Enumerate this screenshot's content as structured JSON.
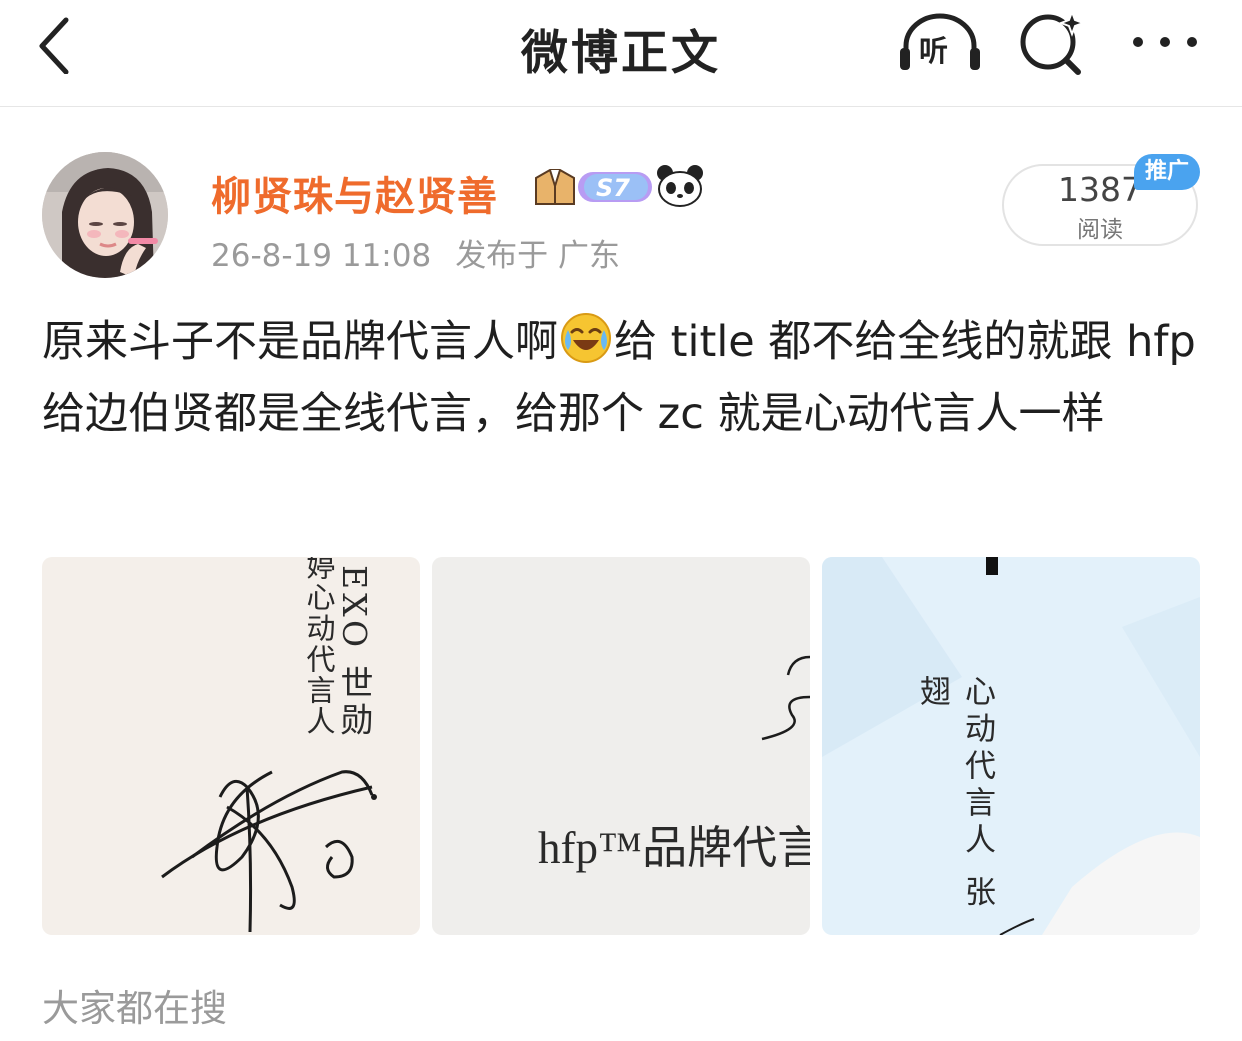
{
  "nav": {
    "title": "微博正文",
    "listen_label": "听",
    "back_icon": "chevron-left-icon",
    "search_icon": "search-sparkle-icon",
    "more_icon": "more-dots-icon"
  },
  "post": {
    "author": "柳贤珠与赵贤善",
    "badge_level": "S7",
    "date": "26-8-19 11:08",
    "location": "发布于 广东",
    "read_count": "1387",
    "read_label": "阅读",
    "promo_tag": "推广",
    "text_part1": "原来斗子不是品牌代言人啊",
    "text_part2": "给 title 都不给全线的就跟 hfp 给边伯贤都是全线代言，给那个 zc 就是心动代言人一样",
    "images": [
      {
        "col1": "婷心动代言人",
        "col2": "EXO 世勋"
      },
      {
        "caption": "hfp™品牌代言"
      },
      {
        "caption": "心动代言人 张翅"
      }
    ]
  },
  "trending": {
    "title": "大家都在搜"
  },
  "colors": {
    "username": "#ef6b2c",
    "promo": "#4aa3ef",
    "meta": "#9a9a9a"
  }
}
